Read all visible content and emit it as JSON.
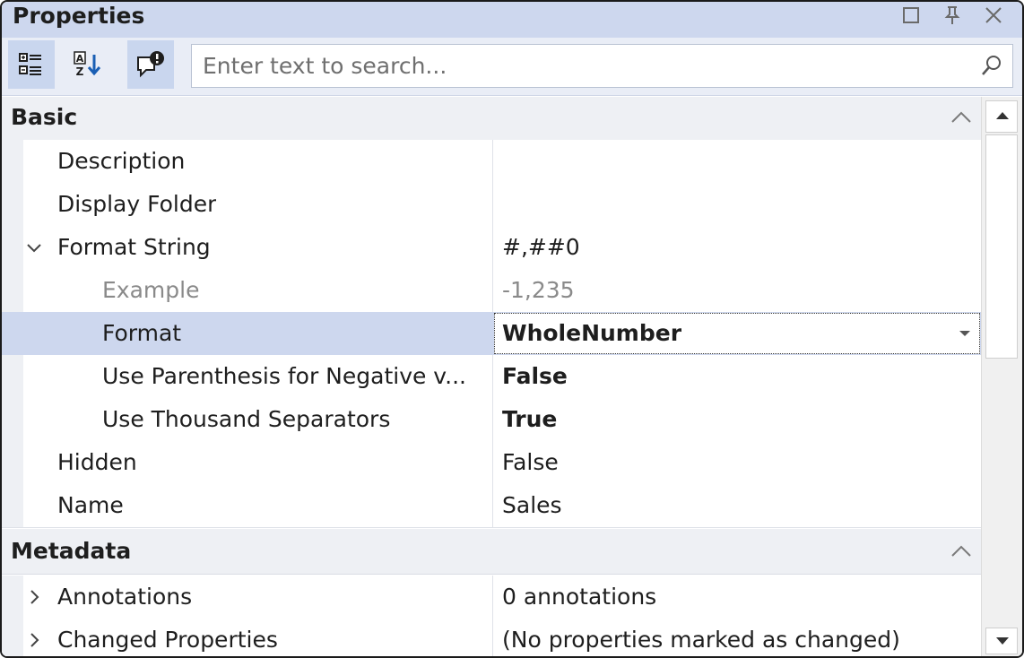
{
  "window": {
    "title": "Properties"
  },
  "search": {
    "placeholder": "Enter text to search..."
  },
  "categories": [
    {
      "label": "Basic"
    },
    {
      "label": "Metadata"
    }
  ],
  "properties": [
    {
      "name": "Description",
      "value": ""
    },
    {
      "name": "Display Folder",
      "value": ""
    },
    {
      "name": "Format String",
      "value": "#,##0"
    },
    {
      "name": "Example",
      "value": "-1,235"
    },
    {
      "name": "Format",
      "value": "WholeNumber"
    },
    {
      "name": "Use Parenthesis for Negative v...",
      "value": "False"
    },
    {
      "name": "Use Thousand Separators",
      "value": "True"
    },
    {
      "name": "Hidden",
      "value": "False"
    },
    {
      "name": "Name",
      "value": "Sales"
    },
    {
      "name": "Annotations",
      "value": "0 annotations"
    },
    {
      "name": "Changed Properties",
      "value": "(No properties marked as changed)"
    }
  ],
  "colors": {
    "titlebar": "#cdd7ee",
    "selected_row": "#cdd7ee",
    "category_bg": "#eef0f4"
  }
}
